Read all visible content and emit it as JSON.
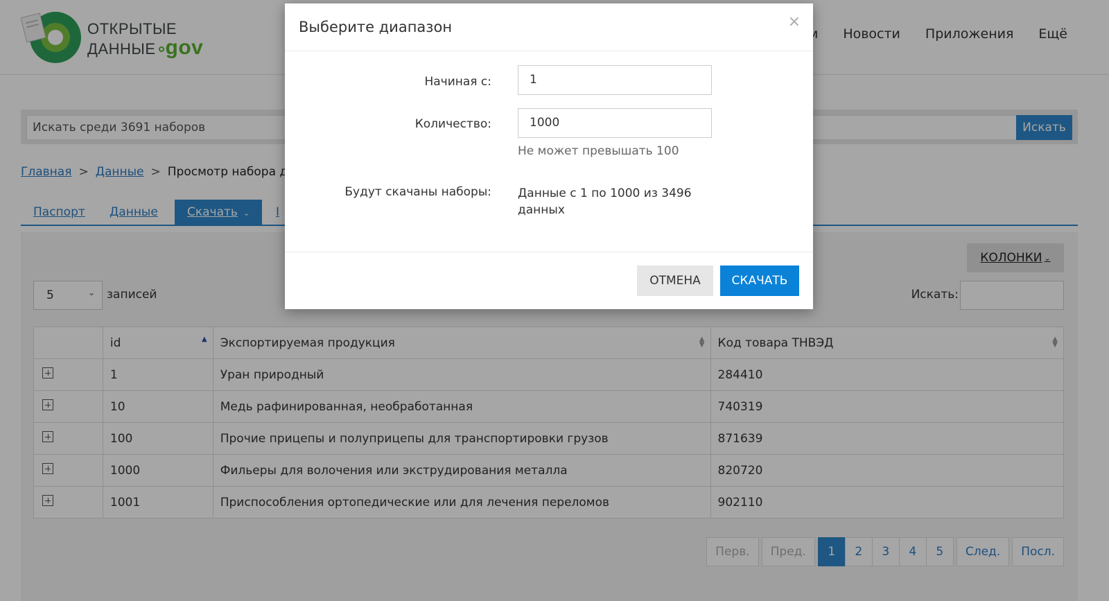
{
  "header": {
    "logo_line1": "ОТКРЫТЫЕ",
    "logo_line2": "ДАННЫЕ",
    "logo_gov": "gov",
    "nav": [
      "ам",
      "Новости",
      "Приложения",
      "Ещё"
    ]
  },
  "search": {
    "placeholder": "Искать среди 3691 наборов",
    "button": "Искать"
  },
  "breadcrumb": {
    "items": [
      "Главная",
      "Данные"
    ],
    "current": "Просмотр набора данн",
    "separator": ">"
  },
  "tabs": [
    {
      "label": "Паспорт"
    },
    {
      "label": "Данные"
    },
    {
      "label": "Скачать"
    },
    {
      "label": "I"
    }
  ],
  "table_controls": {
    "columns_button": "КОЛОНКИ",
    "length_value": "5",
    "length_label": "записей",
    "search_label": "Искать:"
  },
  "table": {
    "headers": [
      "",
      "id",
      "Экспортируемая продукция",
      "Код товара ТНВЭД"
    ],
    "rows": [
      {
        "id": "1",
        "product": "Уран природный",
        "code": "284410"
      },
      {
        "id": "10",
        "product": "Медь рафинированная, необработанная",
        "code": "740319"
      },
      {
        "id": "100",
        "product": "Прочие прицепы и полуприцепы для транспортировки грузов",
        "code": "871639"
      },
      {
        "id": "1000",
        "product": "Фильеры для волочения или экструдирования металла",
        "code": "820720"
      },
      {
        "id": "1001",
        "product": "Приспособления ортопедические или для лечения переломов",
        "code": "902110"
      }
    ]
  },
  "pager": {
    "first": "Перв.",
    "prev": "Пред.",
    "pages": [
      "1",
      "2",
      "3",
      "4",
      "5"
    ],
    "next": "След.",
    "last": "Посл."
  },
  "modal": {
    "title": "Выберите диапазон",
    "close": "×",
    "start_label": "Начиная с:",
    "start_value": "1",
    "count_label": "Количество:",
    "count_value": "1000",
    "count_hint": "Не может превышать 100",
    "result_label": "Будут скачаны наборы:",
    "result_value": "Данные с 1 по 1000 из 3496 данных",
    "cancel": "ОТМЕНА",
    "download": "СКАЧАТЬ"
  },
  "colors": {
    "primary": "#2f86c9",
    "download_button": "#0a82d8",
    "logo_green": "#5ab031"
  }
}
